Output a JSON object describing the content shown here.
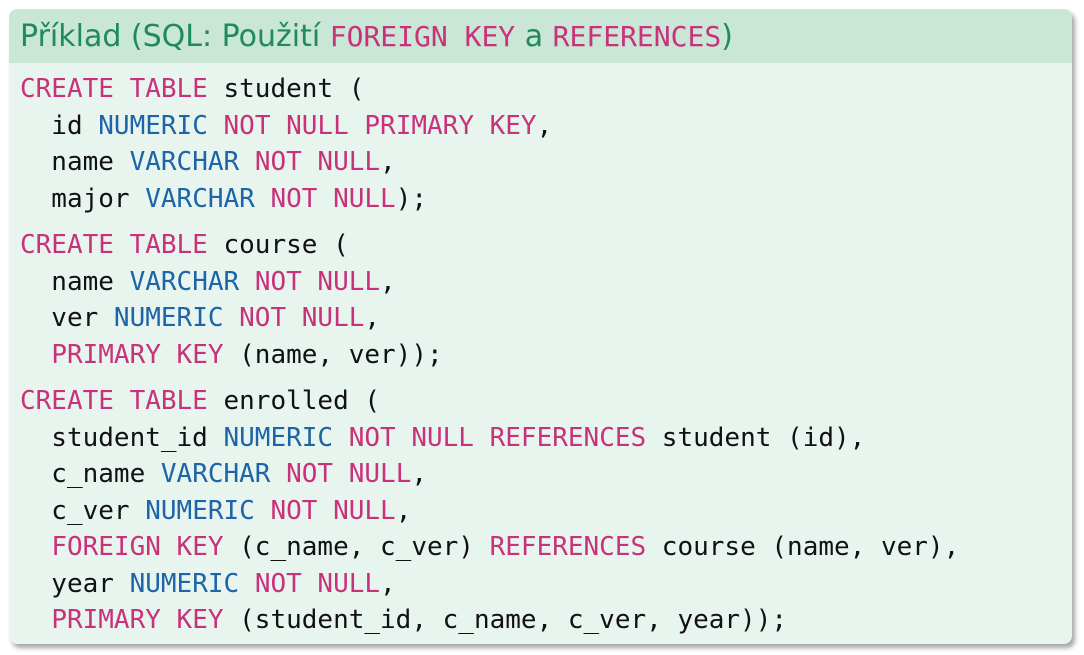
{
  "title": {
    "prefix": "Příklad (SQL: Použití ",
    "kw1": "FOREIGN KEY",
    "middle": " a ",
    "kw2": "REFERENCES",
    "suffix": ")"
  },
  "statements": [
    {
      "lines": [
        [
          {
            "t": "CREATE TABLE",
            "c": "kw"
          },
          {
            "t": " student ("
          }
        ],
        [
          {
            "t": "  id "
          },
          {
            "t": "NUMERIC",
            "c": "ty"
          },
          {
            "t": " "
          },
          {
            "t": "NOT NULL PRIMARY KEY",
            "c": "kw"
          },
          {
            "t": ","
          }
        ],
        [
          {
            "t": "  name "
          },
          {
            "t": "VARCHAR",
            "c": "ty"
          },
          {
            "t": " "
          },
          {
            "t": "NOT NULL",
            "c": "kw"
          },
          {
            "t": ","
          }
        ],
        [
          {
            "t": "  major "
          },
          {
            "t": "VARCHAR",
            "c": "ty"
          },
          {
            "t": " "
          },
          {
            "t": "NOT NULL",
            "c": "kw"
          },
          {
            "t": ");"
          }
        ]
      ]
    },
    {
      "lines": [
        [
          {
            "t": "CREATE TABLE",
            "c": "kw"
          },
          {
            "t": " course ("
          }
        ],
        [
          {
            "t": "  name "
          },
          {
            "t": "VARCHAR",
            "c": "ty"
          },
          {
            "t": " "
          },
          {
            "t": "NOT NULL",
            "c": "kw"
          },
          {
            "t": ","
          }
        ],
        [
          {
            "t": "  ver "
          },
          {
            "t": "NUMERIC",
            "c": "ty"
          },
          {
            "t": " "
          },
          {
            "t": "NOT NULL",
            "c": "kw"
          },
          {
            "t": ","
          }
        ],
        [
          {
            "t": "  "
          },
          {
            "t": "PRIMARY KEY",
            "c": "kw"
          },
          {
            "t": " (name, ver));"
          }
        ]
      ]
    },
    {
      "lines": [
        [
          {
            "t": "CREATE TABLE",
            "c": "kw"
          },
          {
            "t": " enrolled ("
          }
        ],
        [
          {
            "t": "  student_id "
          },
          {
            "t": "NUMERIC",
            "c": "ty"
          },
          {
            "t": " "
          },
          {
            "t": "NOT NULL REFERENCES",
            "c": "kw"
          },
          {
            "t": " student (id),"
          }
        ],
        [
          {
            "t": "  c_name "
          },
          {
            "t": "VARCHAR",
            "c": "ty"
          },
          {
            "t": " "
          },
          {
            "t": "NOT NULL",
            "c": "kw"
          },
          {
            "t": ","
          }
        ],
        [
          {
            "t": "  c_ver "
          },
          {
            "t": "NUMERIC",
            "c": "ty"
          },
          {
            "t": " "
          },
          {
            "t": "NOT NULL",
            "c": "kw"
          },
          {
            "t": ","
          }
        ],
        [
          {
            "t": "  "
          },
          {
            "t": "FOREIGN KEY",
            "c": "kw"
          },
          {
            "t": " (c_name, c_ver) "
          },
          {
            "t": "REFERENCES",
            "c": "kw"
          },
          {
            "t": " course (name, ver),"
          }
        ],
        [
          {
            "t": "  year "
          },
          {
            "t": "NUMERIC",
            "c": "ty"
          },
          {
            "t": " "
          },
          {
            "t": "NOT NULL",
            "c": "kw"
          },
          {
            "t": ","
          }
        ],
        [
          {
            "t": "  "
          },
          {
            "t": "PRIMARY KEY",
            "c": "kw"
          },
          {
            "t": " (student_id, c_name, c_ver, year));"
          }
        ]
      ]
    }
  ],
  "colors": {
    "keyword": "#c8327a",
    "type": "#1d64a8",
    "title": "#1f8a5b",
    "title_bar": "#c9e6d6",
    "body_bg": "#e8f4ee"
  }
}
